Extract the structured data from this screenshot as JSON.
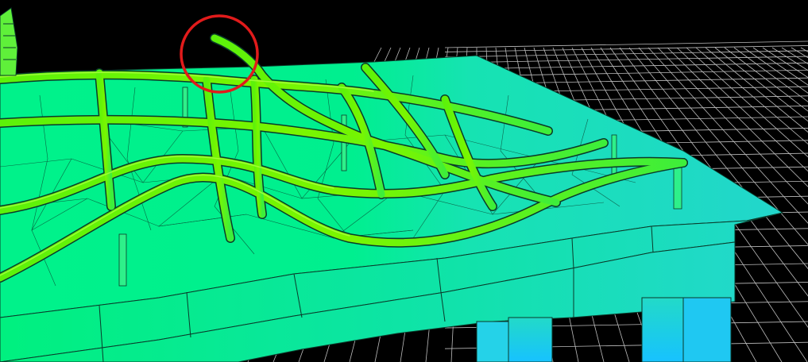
{
  "viewport": {
    "background": "#000000",
    "grid_color": "#bdbdbd"
  },
  "stress_palette": {
    "high": "#7cf500",
    "mid": "#00f27a",
    "low": "#20d9c4",
    "lowest": "#17c8ff",
    "edge": "#0a3a2a"
  },
  "highlight": {
    "color": "#e11b1b",
    "shape": "circle"
  }
}
